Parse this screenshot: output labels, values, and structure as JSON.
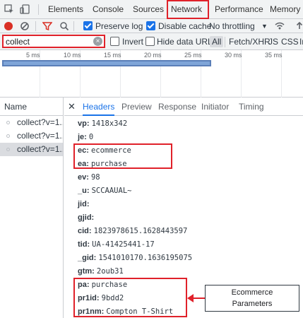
{
  "tabs": [
    "Elements",
    "Console",
    "Sources",
    "Network",
    "Performance",
    "Memory"
  ],
  "toolbar": {
    "preserve_log": "Preserve log",
    "disable_cache": "Disable cache",
    "throttling": "No throttling"
  },
  "filter": {
    "value": "collect",
    "invert": "Invert",
    "hide_data_urls": "Hide data URLs",
    "types": [
      "All",
      "Fetch/XHR",
      "JS",
      "CSS",
      "Im"
    ]
  },
  "timeline": {
    "labels": [
      "5 ms",
      "10 ms",
      "15 ms",
      "20 ms",
      "25 ms",
      "30 ms",
      "35 ms"
    ]
  },
  "requests": {
    "header": "Name",
    "items": [
      "collect?v=1...",
      "collect?v=1...",
      "collect?v=1..."
    ]
  },
  "detail_tabs": [
    "Headers",
    "Preview",
    "Response",
    "Initiator",
    "Timing"
  ],
  "params": [
    {
      "key": "vp:",
      "value": "1418x342"
    },
    {
      "key": "je:",
      "value": "0"
    },
    {
      "key": "ec:",
      "value": "ecommerce"
    },
    {
      "key": "ea:",
      "value": "purchase"
    },
    {
      "key": "ev:",
      "value": "98"
    },
    {
      "key": "_u:",
      "value": "SCCAAUAL~"
    },
    {
      "key": "jid:",
      "value": ""
    },
    {
      "key": "gjid:",
      "value": ""
    },
    {
      "key": "cid:",
      "value": "1823978615.1628443597"
    },
    {
      "key": "tid:",
      "value": "UA-41425441-17"
    },
    {
      "key": "_gid:",
      "value": "1541010170.1636195075"
    },
    {
      "key": "gtm:",
      "value": "2oub31"
    },
    {
      "key": "pa:",
      "value": "purchase"
    },
    {
      "key": "pr1id:",
      "value": "9bdd2"
    },
    {
      "key": "pr1nm:",
      "value": "Compton T-Shirt"
    }
  ],
  "annotation": {
    "line1": "Ecommerce",
    "line2": "Parameters"
  },
  "colors": {
    "highlight": "#e0212a",
    "accent": "#1a73e8",
    "record": "#d93025"
  }
}
